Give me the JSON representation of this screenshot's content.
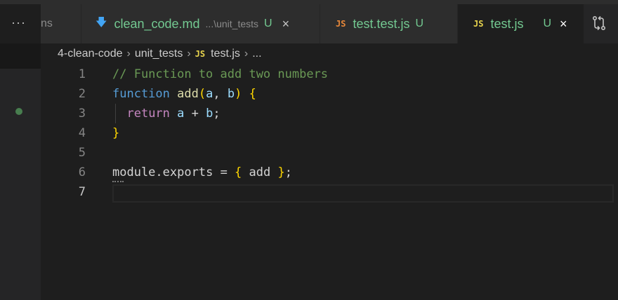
{
  "tabs": [
    {
      "label": "ns",
      "partial": true
    },
    {
      "icon": "markdown-icon",
      "label": "clean_code.md",
      "description": "...\\unit_tests",
      "status": "U",
      "close": "×"
    },
    {
      "icon": "js-icon",
      "badge": "JS",
      "label": "test.test.js",
      "status": "U"
    },
    {
      "icon": "js-icon",
      "badge": "JS",
      "label": "test.js",
      "status": "U",
      "close": "×",
      "active": true
    }
  ],
  "more_actions": "···",
  "breadcrumb": {
    "items": [
      "4-clean-code",
      "unit_tests",
      "test.js",
      "..."
    ],
    "badge": "JS",
    "separator": "›"
  },
  "editor": {
    "lines": [
      {
        "number": "1"
      },
      {
        "number": "2"
      },
      {
        "number": "3"
      },
      {
        "number": "4"
      },
      {
        "number": "5"
      },
      {
        "number": "6"
      },
      {
        "number": "7"
      }
    ],
    "tokens": {
      "comment": "// Function to add two numbers",
      "kw_function": "function",
      "fn_name": "add",
      "open_paren": "(",
      "param_a": "a",
      "comma": ", ",
      "param_b": "b",
      "close_paren": ")",
      "open_brace": "{",
      "kw_return": "return",
      "ret_a": "a",
      "plus": " + ",
      "ret_b": "b",
      "semicolon": ";",
      "close_brace": "}",
      "module": "module",
      "dot": ".",
      "exports": "exports",
      "equals": " = ",
      "obj_open": "{",
      "obj_add": " add ",
      "obj_close": "}",
      "final_semicolon": ";"
    },
    "current_line": 7
  },
  "colors": {
    "background": "#1e1e1e",
    "modified_green": "#73c991",
    "js_orange": "#e8883a",
    "js_yellow": "#e8d44d",
    "markdown_blue": "#42a5f5"
  }
}
